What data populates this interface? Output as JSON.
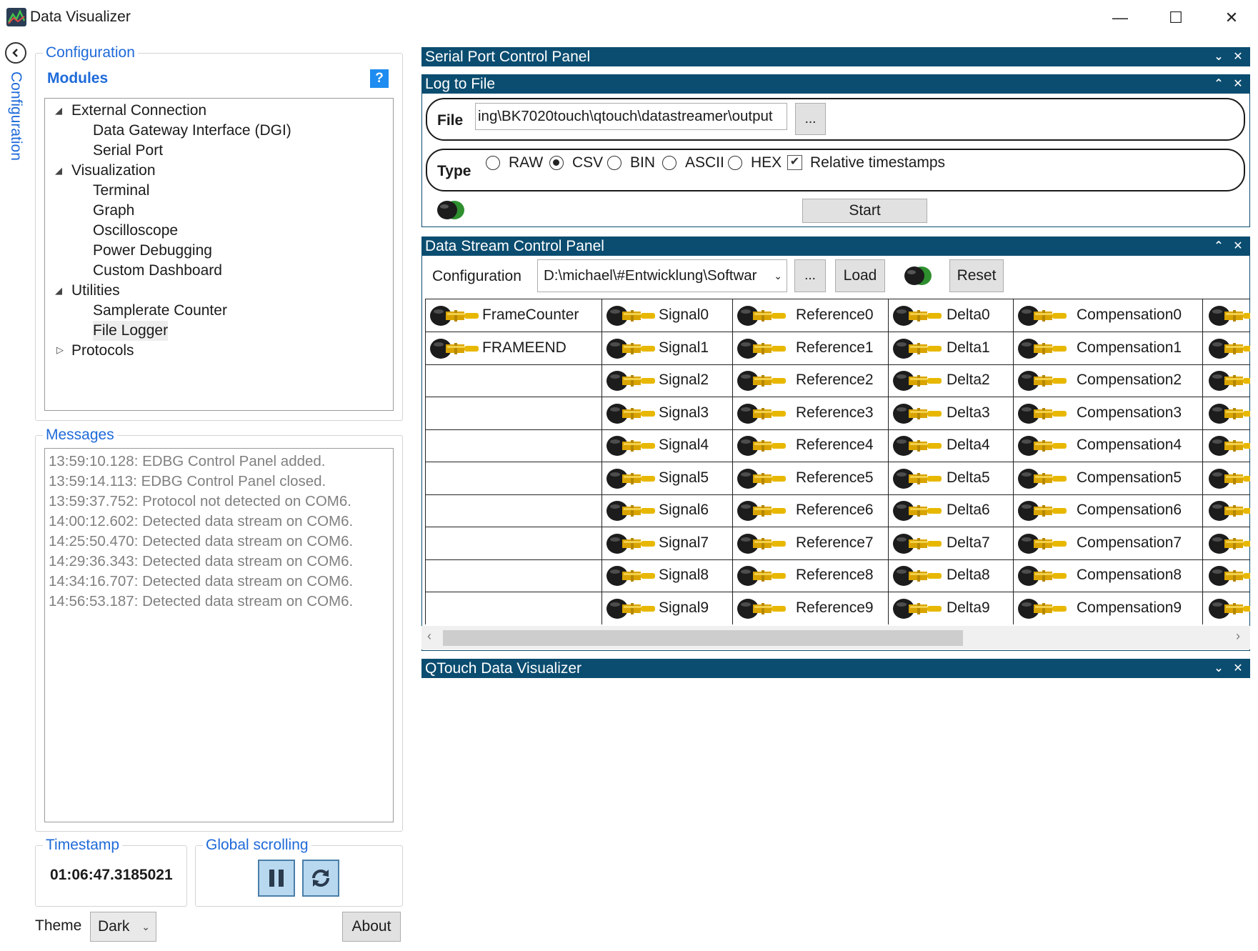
{
  "window": {
    "title": "Data Visualizer",
    "controls": {
      "minimize": "—",
      "maximize": "☐",
      "close": "✕"
    }
  },
  "side_tab": {
    "label": "Configuration",
    "collapse_icon": "chevron-left-icon"
  },
  "configuration": {
    "title": "Configuration",
    "modules_label": "Modules",
    "help_label": "?",
    "tree": [
      {
        "label": "External Connection",
        "level": 0,
        "expanded": true
      },
      {
        "label": "Data Gateway Interface (DGI)",
        "level": 1
      },
      {
        "label": "Serial Port",
        "level": 1
      },
      {
        "label": "Visualization",
        "level": 0,
        "expanded": true
      },
      {
        "label": "Terminal",
        "level": 1
      },
      {
        "label": "Graph",
        "level": 1
      },
      {
        "label": "Oscilloscope",
        "level": 1
      },
      {
        "label": "Power Debugging",
        "level": 1
      },
      {
        "label": "Custom Dashboard",
        "level": 1
      },
      {
        "label": "Utilities",
        "level": 0,
        "expanded": true
      },
      {
        "label": "Samplerate Counter",
        "level": 1
      },
      {
        "label": "File Logger",
        "level": 1,
        "selected": true
      },
      {
        "label": "Protocols",
        "level": 0,
        "expanded": false
      }
    ]
  },
  "messages": {
    "title": "Messages",
    "items": [
      "13:59:10.128: EDBG Control Panel added.",
      "13:59:14.113: EDBG Control Panel closed.",
      "13:59:37.752: Protocol not detected on COM6.",
      "14:00:12.602: Detected data stream on COM6.",
      "14:25:50.470: Detected data stream on COM6.",
      "14:29:36.343: Detected data stream on COM6.",
      "14:34:16.707: Detected data stream on COM6.",
      "14:56:53.187: Detected data stream on COM6."
    ]
  },
  "timestamp": {
    "title": "Timestamp",
    "value": "01:06:47.3185021"
  },
  "global_scrolling": {
    "title": "Global scrolling",
    "pause_icon": "pause-icon",
    "refresh_icon": "refresh-icon"
  },
  "theme": {
    "label": "Theme",
    "value": "Dark"
  },
  "about_label": "About",
  "panels": {
    "serial_port": {
      "title": "Serial Port Control Panel",
      "collapse": "⌄",
      "close": "✕"
    },
    "log_to_file": {
      "title": "Log to File",
      "collapse": "⌃",
      "close": "✕",
      "file_label": "File",
      "file_value": "ing\\BK7020touch\\qtouch\\datastreamer\\output",
      "browse_label": "...",
      "type_label": "Type",
      "types": [
        {
          "label": "RAW",
          "selected": false
        },
        {
          "label": "CSV",
          "selected": true
        },
        {
          "label": "BIN",
          "selected": false
        },
        {
          "label": "ASCII",
          "selected": false
        },
        {
          "label": "HEX",
          "selected": false
        }
      ],
      "relative_timestamps_label": "Relative timestamps",
      "relative_timestamps_checked": true,
      "start_label": "Start"
    },
    "data_stream": {
      "title": "Data Stream Control Panel",
      "collapse": "⌃",
      "close": "✕",
      "config_label": "Configuration",
      "config_value": "D:\\michael\\#Entwicklung\\Softwar",
      "browse_label": "...",
      "load_label": "Load",
      "reset_label": "Reset",
      "columns": [
        [
          "FrameCounter",
          "FRAMEEND"
        ],
        [
          "Signal0",
          "Signal1",
          "Signal2",
          "Signal3",
          "Signal4",
          "Signal5",
          "Signal6",
          "Signal7",
          "Signal8",
          "Signal9"
        ],
        [
          "Reference0",
          "Reference1",
          "Reference2",
          "Reference3",
          "Reference4",
          "Reference5",
          "Reference6",
          "Reference7",
          "Reference8",
          "Reference9"
        ],
        [
          "Delta0",
          "Delta1",
          "Delta2",
          "Delta3",
          "Delta4",
          "Delta5",
          "Delta6",
          "Delta7",
          "Delta8",
          "Delta9"
        ],
        [
          "Compensation0",
          "Compensation1",
          "Compensation2",
          "Compensation3",
          "Compensation4",
          "Compensation5",
          "Compensation6",
          "Compensation7",
          "Compensation8",
          "Compensation9"
        ]
      ]
    },
    "qtouch": {
      "title": "QTouch Data Visualizer",
      "collapse": "⌄",
      "close": "✕"
    }
  },
  "colors": {
    "accent": "#1e6ad9",
    "panel_header": "#0b4d70",
    "jack_gold": "#e0a800",
    "led_green": "#2f8f2f"
  }
}
